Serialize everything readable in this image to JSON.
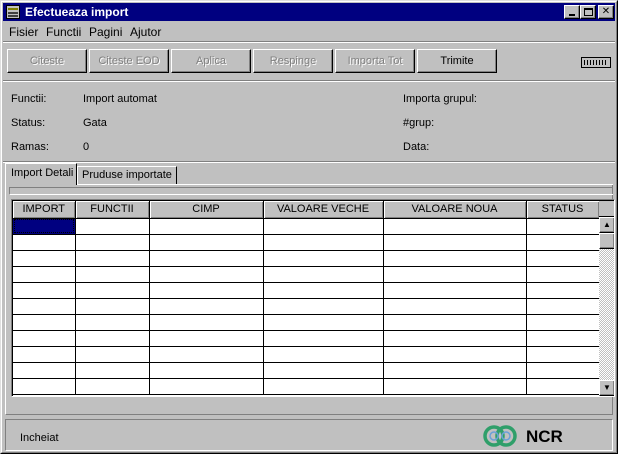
{
  "window": {
    "title": "Efectueaza import"
  },
  "menu": {
    "items": [
      {
        "label": "Fisier"
      },
      {
        "label": "Functii"
      },
      {
        "label": "Pagini"
      },
      {
        "label": "Ajutor"
      }
    ]
  },
  "toolbar": {
    "buttons": [
      {
        "label": "Citeste",
        "enabled": false
      },
      {
        "label": "Citeste EOD",
        "enabled": false
      },
      {
        "label": "Aplica",
        "enabled": false
      },
      {
        "label": "Respinge",
        "enabled": false
      },
      {
        "label": "Importa Tot",
        "enabled": false
      },
      {
        "label": "Trimite",
        "enabled": true
      }
    ],
    "right_icon": "keyboard-icon"
  },
  "info": {
    "functii_label": "Functii:",
    "functii_value": "Import automat",
    "status_label": "Status:",
    "status_value": "Gata",
    "ramas_label": "Ramas:",
    "ramas_value": "0",
    "importa_grupul_label": "Importa grupul:",
    "grup_label": "#grup:",
    "data_label": "Data:"
  },
  "tabs": [
    {
      "label": "Import Detali",
      "active": true
    },
    {
      "label": "Pruduse importate",
      "active": false
    }
  ],
  "table": {
    "columns": [
      "IMPORT",
      "FUNCTII",
      "CIMP",
      "VALOARE VECHE",
      "VALOARE NOUA",
      "STATUS"
    ],
    "row_count": 11,
    "selected_row": 0,
    "selected_column": 0
  },
  "status_bar": {
    "text": "Incheiat",
    "logo_text": "NCR"
  },
  "colors": {
    "title_bar": "#000080",
    "face": "#c0c0c0",
    "selection": "#000080",
    "ncr_logo_green": "#2f9f6a"
  }
}
